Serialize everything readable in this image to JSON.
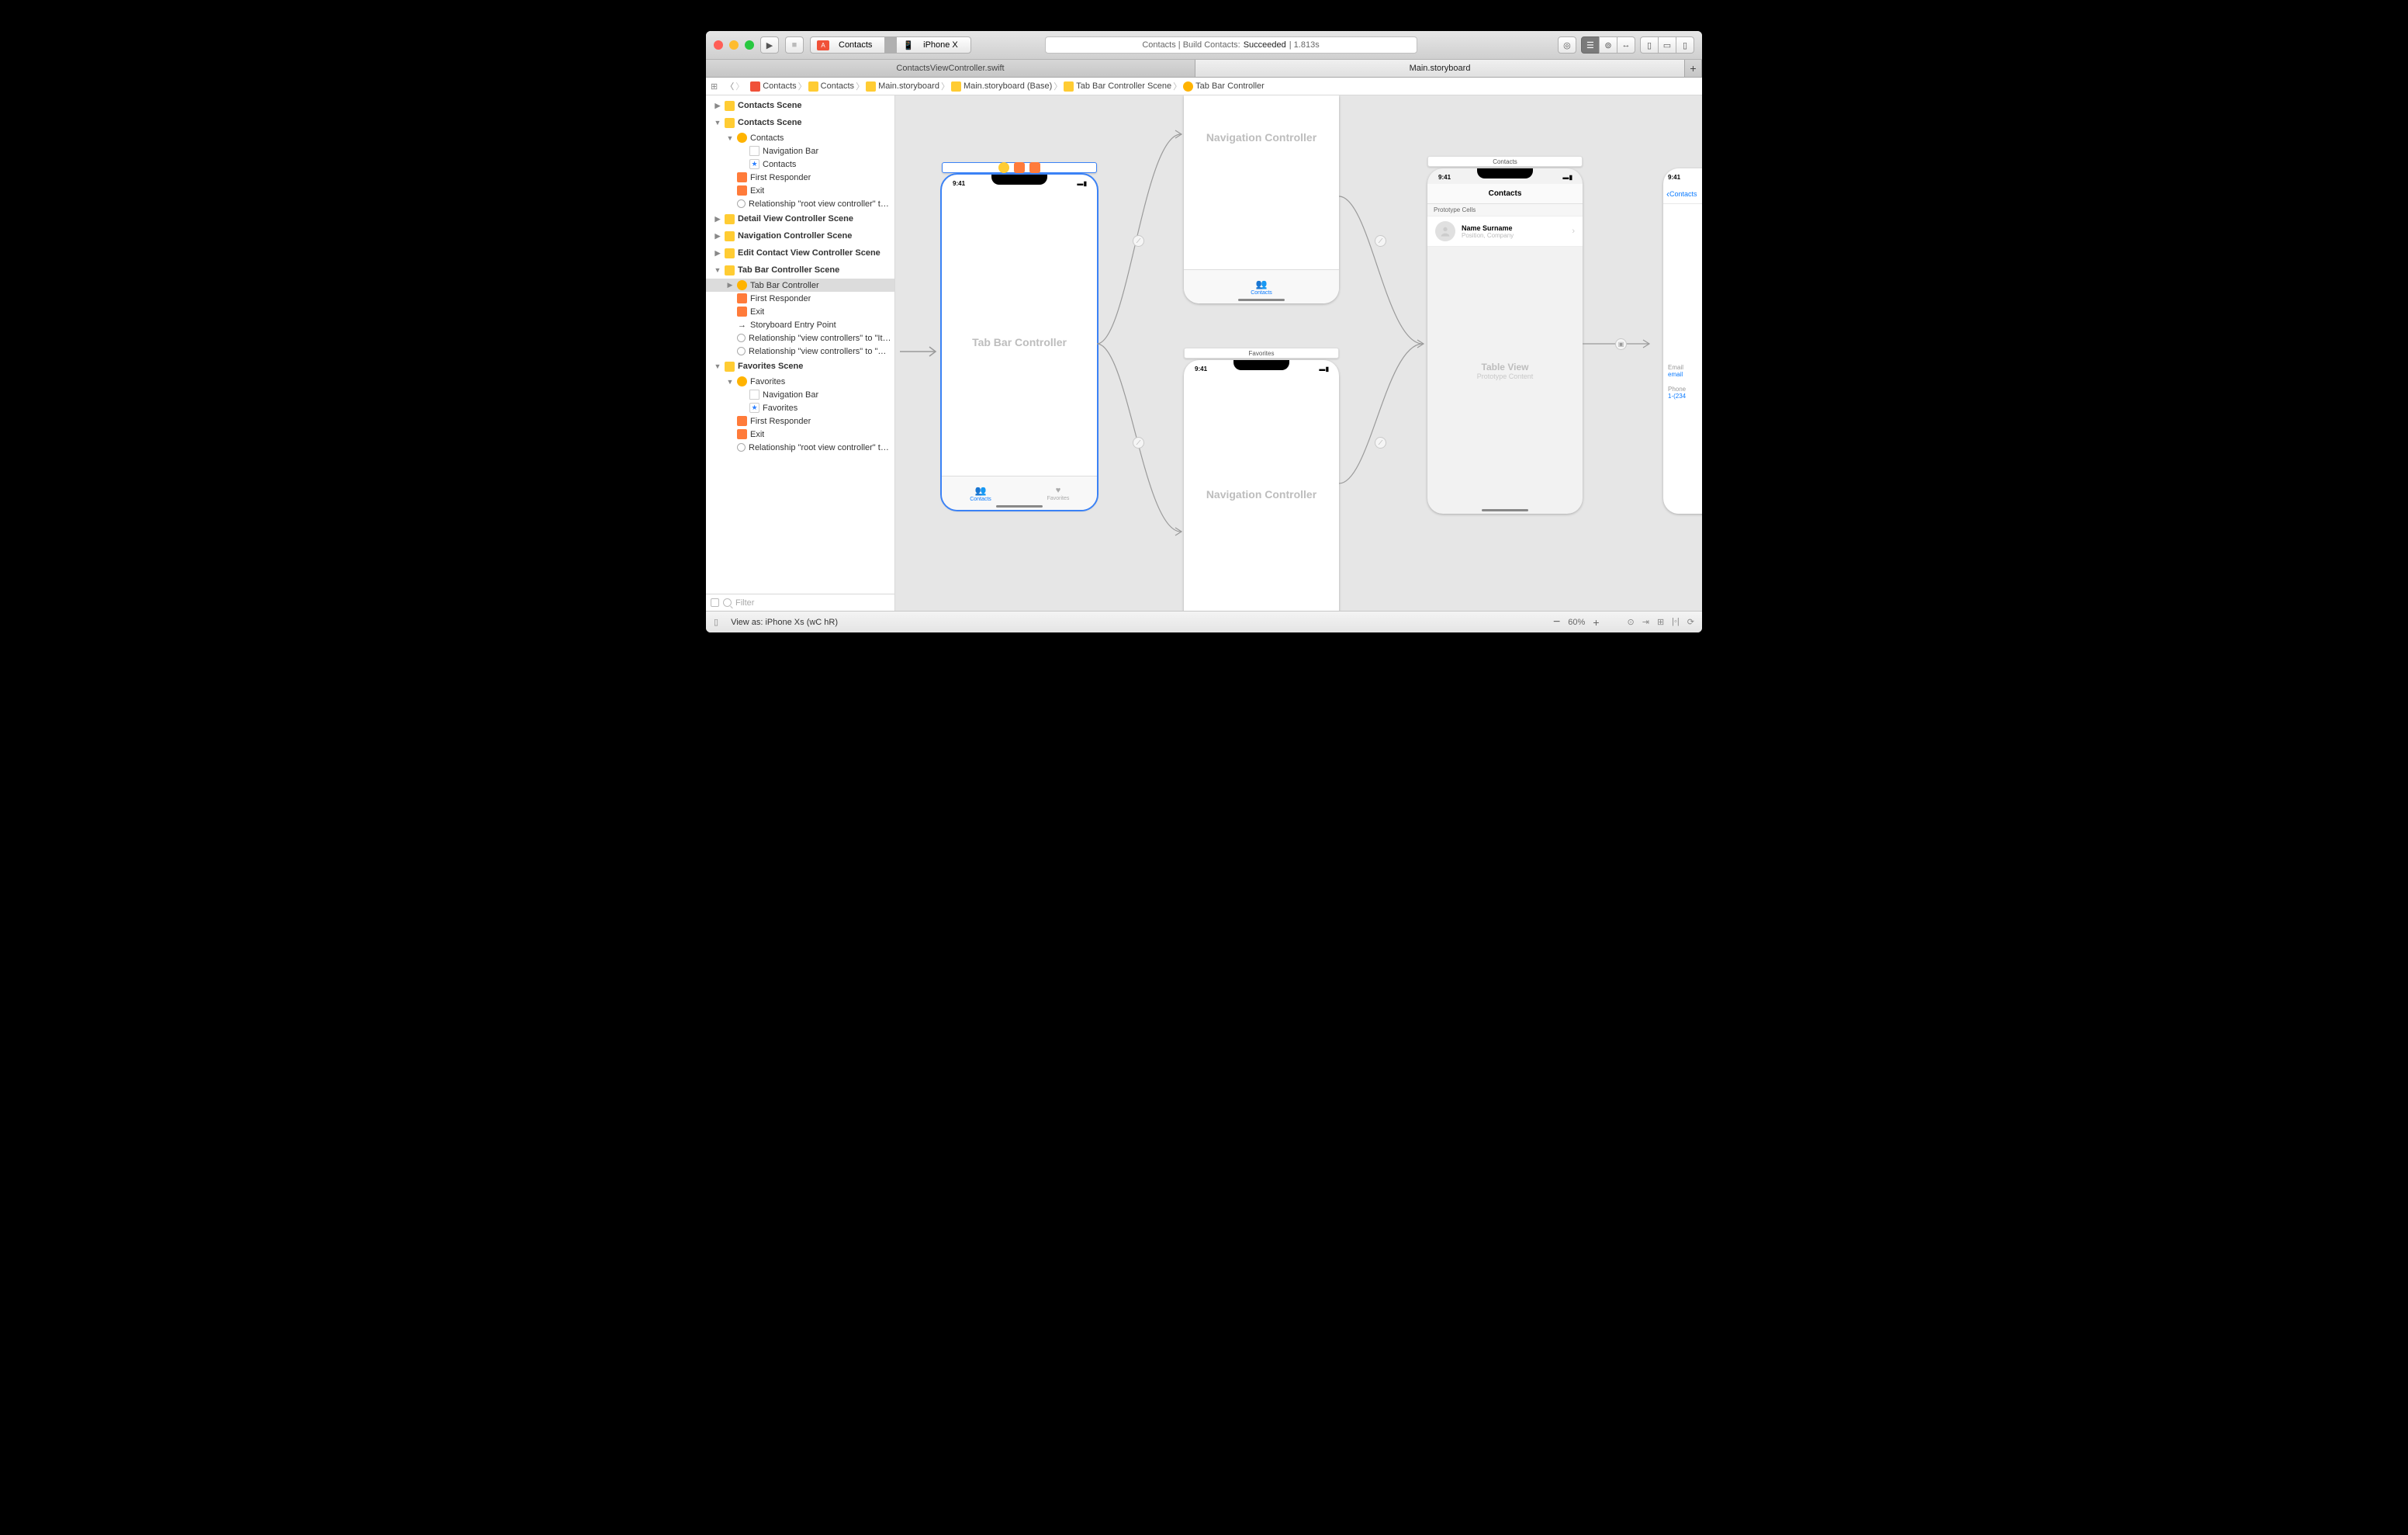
{
  "titlebar": {
    "scheme_target": "Contacts",
    "scheme_device": "iPhone X",
    "activity_prefix": "Contacts | Build Contacts: ",
    "activity_status": "Succeeded",
    "activity_time": " | 1.813s"
  },
  "tabs": {
    "left": "ContactsViewController.swift",
    "right": "Main.storyboard"
  },
  "jumpbar": [
    {
      "icon": "swift",
      "label": "Contacts"
    },
    {
      "icon": "folder",
      "label": "Contacts"
    },
    {
      "icon": "sb",
      "label": "Main.storyboard"
    },
    {
      "icon": "sb",
      "label": "Main.storyboard (Base)"
    },
    {
      "icon": "scene",
      "label": "Tab Bar Controller Scene"
    },
    {
      "icon": "vc",
      "label": "Tab Bar Controller"
    }
  ],
  "outline": [
    {
      "d": 0,
      "tri": "▶",
      "icon": "scene",
      "label": "Contacts Scene",
      "bold": true
    },
    {
      "d": 0,
      "tri": "▼",
      "icon": "scene",
      "label": "Contacts Scene",
      "bold": true
    },
    {
      "d": 1,
      "tri": "▼",
      "icon": "yellowdot",
      "label": "Contacts"
    },
    {
      "d": 2,
      "tri": "",
      "icon": "nb",
      "label": "Navigation Bar"
    },
    {
      "d": 2,
      "tri": "",
      "icon": "star",
      "label": "Contacts"
    },
    {
      "d": 1,
      "tri": "",
      "icon": "cube",
      "label": "First Responder"
    },
    {
      "d": 1,
      "tri": "",
      "icon": "exit",
      "label": "Exit"
    },
    {
      "d": 1,
      "tri": "",
      "icon": "circ",
      "label": "Relationship \"root view controller\" t…"
    },
    {
      "d": 0,
      "tri": "▶",
      "icon": "scene",
      "label": "Detail View Controller Scene",
      "bold": true
    },
    {
      "d": 0,
      "tri": "▶",
      "icon": "scene",
      "label": "Navigation Controller Scene",
      "bold": true
    },
    {
      "d": 0,
      "tri": "▶",
      "icon": "scene",
      "label": "Edit Contact View Controller Scene",
      "bold": true
    },
    {
      "d": 0,
      "tri": "▼",
      "icon": "scene",
      "label": "Tab Bar Controller Scene",
      "bold": true
    },
    {
      "d": 1,
      "tri": "▶",
      "icon": "vc",
      "label": "Tab Bar Controller",
      "sel": true
    },
    {
      "d": 1,
      "tri": "",
      "icon": "cube",
      "label": "First Responder"
    },
    {
      "d": 1,
      "tri": "",
      "icon": "exit",
      "label": "Exit"
    },
    {
      "d": 1,
      "tri": "",
      "icon": "arrow",
      "label": "Storyboard Entry Point"
    },
    {
      "d": 1,
      "tri": "",
      "icon": "circ",
      "label": "Relationship \"view controllers\" to \"It…"
    },
    {
      "d": 1,
      "tri": "",
      "icon": "circ",
      "label": "Relationship \"view controllers\" to \"…"
    },
    {
      "d": 0,
      "tri": "▼",
      "icon": "scene",
      "label": "Favorites Scene",
      "bold": true
    },
    {
      "d": 1,
      "tri": "▼",
      "icon": "yellowdot",
      "label": "Favorites"
    },
    {
      "d": 2,
      "tri": "",
      "icon": "nb",
      "label": "Navigation Bar"
    },
    {
      "d": 2,
      "tri": "",
      "icon": "star",
      "label": "Favorites"
    },
    {
      "d": 1,
      "tri": "",
      "icon": "cube",
      "label": "First Responder"
    },
    {
      "d": 1,
      "tri": "",
      "icon": "exit",
      "label": "Exit"
    },
    {
      "d": 1,
      "tri": "",
      "icon": "circ",
      "label": "Relationship \"root view controller\" t…"
    }
  ],
  "filter_placeholder": "Filter",
  "canvas": {
    "tabbar_title": "Tab Bar Controller",
    "tabbar_tabs": {
      "contacts": "Contacts",
      "favorites": "Favorites"
    },
    "nav_title": "Navigation Controller",
    "favorites_badge": "Favorites",
    "contacts_badge": "Contacts",
    "contacts_navtitle": "Contacts",
    "contacts_back": "Contacts",
    "proto_header": "Prototype Cells",
    "cell_name": "Name Surname",
    "cell_sub": "Position, Company",
    "tableview_label": "Table View",
    "tableview_sub": "Prototype Content",
    "status_time": "9:41",
    "detail_email_label": "Email",
    "detail_email_value": "email",
    "detail_phone_label": "Phone",
    "detail_phone_value": "1-(234"
  },
  "bottombar": {
    "viewas": "View as: iPhone Xs (wC hR)",
    "zoom": "60%"
  }
}
